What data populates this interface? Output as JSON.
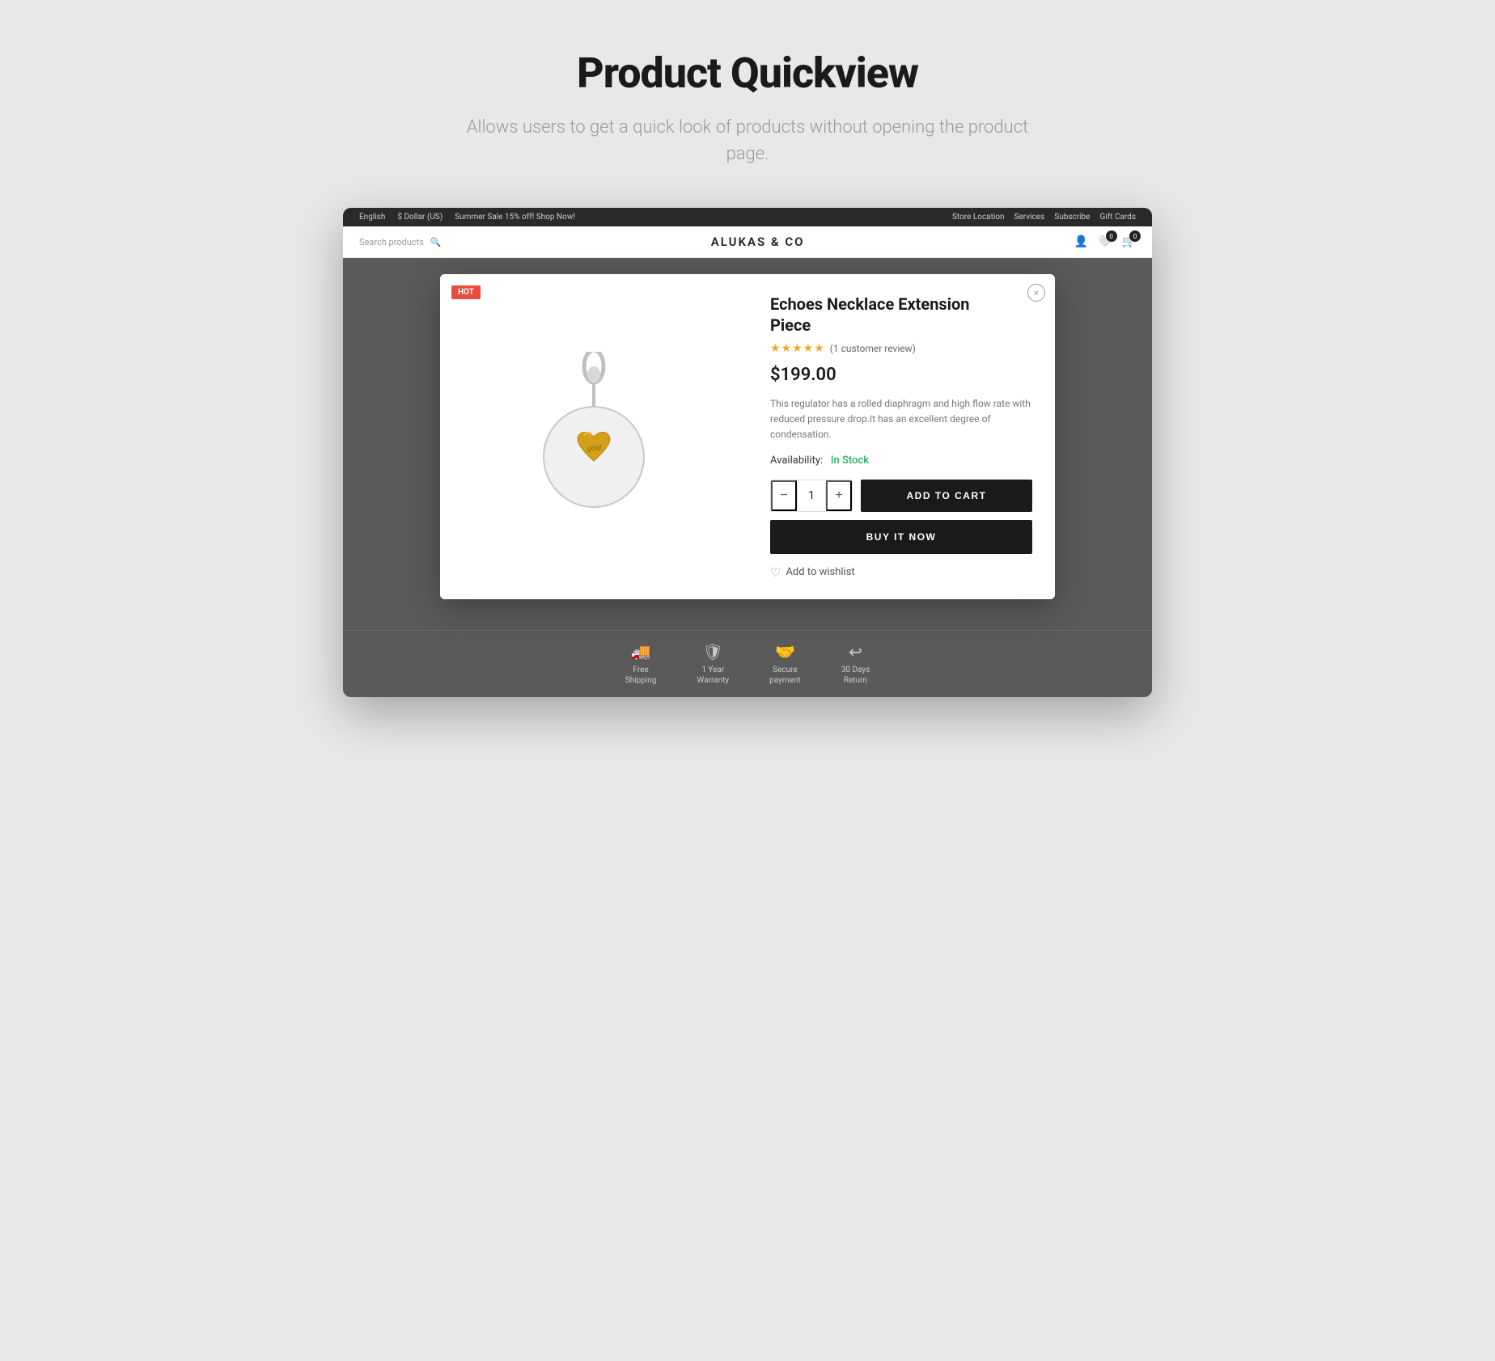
{
  "header": {
    "title": "Product Quickview",
    "subtitle": "Allows users to get a quick look of products without opening the product page."
  },
  "topbar": {
    "left": [
      "English",
      "$ Dollar (US)",
      "Summer Sale 15% off! Shop Now!"
    ],
    "right": [
      "Store Location",
      "Services",
      "Subscribe",
      "Gift Cards"
    ]
  },
  "nav": {
    "search_placeholder": "Search products",
    "logo": "ALUKAS & CO",
    "cart_count": "0",
    "wishlist_count": "0"
  },
  "modal": {
    "hot_badge": "HOT",
    "close_label": "×",
    "product_name": "Echoes Necklace Extension Piece",
    "stars": "★★★★★",
    "review_count": "(1 customer review)",
    "price": "$199.00",
    "description": "This regulator has a rolled diaphragm and high flow rate with reduced pressure drop.It has an excellent degree of condensation.",
    "availability_label": "Availability:",
    "availability_value": "In Stock",
    "qty_minus": "−",
    "qty_value": "1",
    "qty_plus": "+",
    "add_to_cart": "ADD TO CART",
    "buy_it_now": "BUY IT NOW",
    "wishlist_label": "Add to wishlist"
  },
  "footer_items": [
    {
      "icon": "🚚",
      "label": "Free\nShipping"
    },
    {
      "icon": "🛡",
      "label": "1 Year\nWarranty"
    },
    {
      "icon": "🤝",
      "label": "Secure\npayment"
    },
    {
      "icon": "↩",
      "label": "30 Days\nReturn"
    }
  ]
}
